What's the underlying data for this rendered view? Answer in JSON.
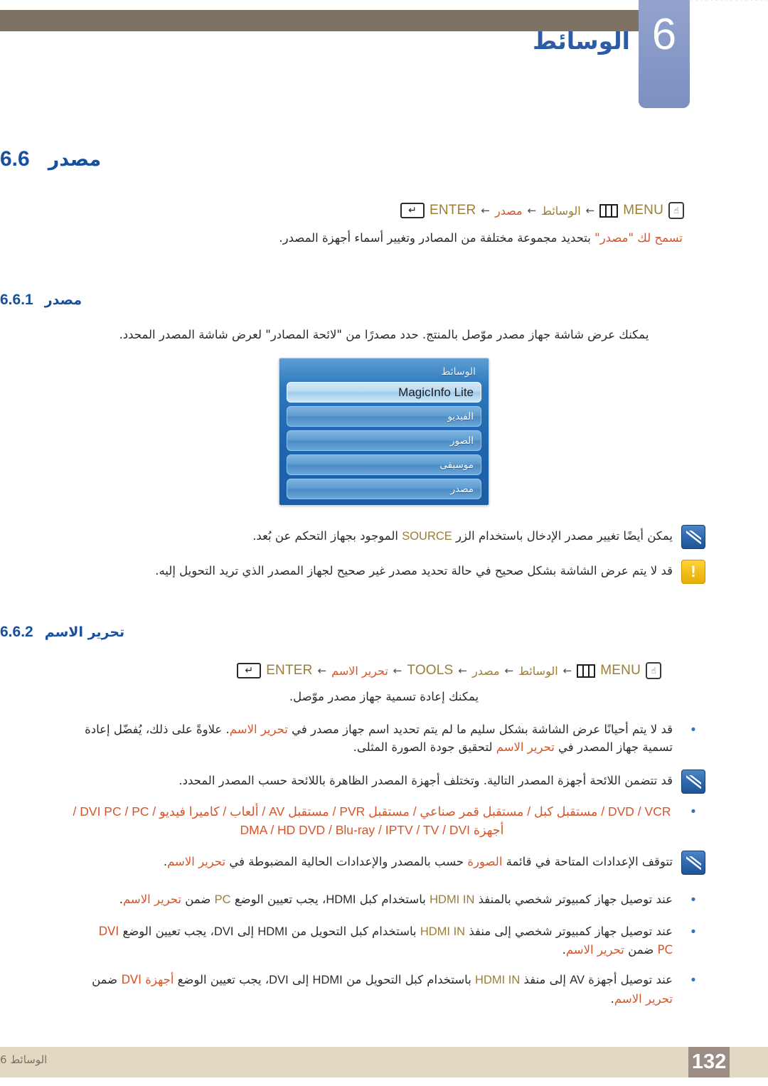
{
  "header": {
    "chapter_number": "6",
    "chapter_title": "الوسائط"
  },
  "section": {
    "number": "6.6",
    "title": "مصدر",
    "breadcrumb": {
      "menu_label": "MENU",
      "step1": "الوسائط",
      "step2": "مصدر",
      "enter_label": "ENTER",
      "arrow": "←",
      "hand_icon": "hand-pointer-icon",
      "menu_icon": "menu-bars-icon",
      "enter_icon": "enter-key-icon"
    },
    "description": "تسمح لك \"مصدر\" بتحديد مجموعة مختلفة من المصادر وتغيير أسماء أجهزة المصدر.",
    "description_highlight": "تسمح لك \"مصدر\""
  },
  "subsection_1": {
    "number": "6.6.1",
    "title": "مصدر",
    "paragraph": "يمكنك عرض شاشة جهاز مصدر موّصل بالمنتج. حدد مصدرًا من \"لائحة المصادر\" لعرض شاشة المصدر المحدد.",
    "osd": {
      "title": "الوسائط",
      "items": [
        {
          "label": "MagicInfo Lite",
          "selected": true
        },
        {
          "label": "الفيديو",
          "selected": false
        },
        {
          "label": "الصور",
          "selected": false
        },
        {
          "label": "موسيقى",
          "selected": false
        },
        {
          "label": "مصدر",
          "selected": false
        }
      ]
    },
    "note_info": "يمكن أيضًا تغيير مصدر الإدخال باستخدام الزر SOURCE الموجود بجهاز التحكم عن بُعد.",
    "note_info_key": "SOURCE",
    "note_warn": "قد لا يتم عرض الشاشة بشكل صحيح في حالة تحديد مصدر غير صحيح لجهاز المصدر الذي تريد التحويل إليه."
  },
  "subsection_2": {
    "number": "6.6.2",
    "title": "تحرير الاسم",
    "breadcrumb": {
      "menu_label": "MENU",
      "step1": "الوسائط",
      "step2": "مصدر",
      "step3": "TOOLS",
      "step4": "تحرير الاسم",
      "enter_label": "ENTER",
      "arrow": "←",
      "hand_icon": "hand-pointer-icon",
      "menu_icon": "menu-bars-icon",
      "enter_icon": "enter-key-icon"
    },
    "intro": "يمكنك إعادة تسمية جهاز مصدر موّصل.",
    "bullet_1": "قد لا يتم أحيانًا عرض الشاشة بشكل سليم ما لم يتم تحديد اسم جهاز مصدر في تحرير الاسم. علاوةً على ذلك، يُفضّل إعادة تسمية جهاز المصدر في تحرير الاسم لتحقيق جودة الصورة المثلى.",
    "note_list_intro": "قد تتضمن اللائحة أجهزة المصدر التالية. وتختلف أجهزة المصدر الظاهرة باللائحة حسب المصدر المحدد.",
    "device_list_line1": "DVD / VCR / مستقبل كبل / مستقبل قمر صناعي / مستقبل PVR / مستقبل AV / ألعاب / كاميرا فيديو / DVI PC / PC /",
    "device_list_line2": "أجهزة DMA / HD DVD / Blu-ray / IPTV / TV / DVI",
    "note_settings": "تتوقف الإعدادات المتاحة في قائمة الصورة حسب بالمصدر والإعدادات الحالية المضبوطة في تحرير الاسم.",
    "bullet_hdmi_pc": "عند توصيل جهاز كمبيوتر شخصي بالمنفذ HDMI IN باستخدام كبل HDMI، يجب تعيين الوضع PC ضمن تحرير الاسم.",
    "bullet_hdmi_dvi_pc": "عند توصيل جهاز كمبيوتر شخصي إلى منفذ HDMI IN باستخدام كبل التحويل من HDMI إلى DVI، يجب تعيين الوضع DVI PC ضمن تحرير الاسم.",
    "bullet_hdmi_dvi_av": "عند توصيل أجهزة AV إلى منفذ HDMI IN باستخدام كبل التحويل من HDMI إلى DVI، يجب تعيين الوضع أجهزة DVI ضمن تحرير الاسم."
  },
  "footer": {
    "chapter_label": "الوسائط 6",
    "page_number": "132"
  },
  "colors": {
    "heading_blue": "#17509e",
    "accent_orange": "#d6552a",
    "accent_gold": "#9b7d38",
    "tab_blue": "#8698c7",
    "header_bar": "#7d7264",
    "footer_bar": "#e2d9c2",
    "page_box": "#9b8d83"
  }
}
